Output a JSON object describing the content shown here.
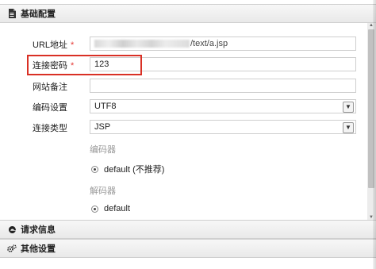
{
  "sections": {
    "basic": {
      "title": "基础配置",
      "icon": "document-icon"
    },
    "request": {
      "title": "请求信息",
      "icon": "edge-icon"
    },
    "other": {
      "title": "其他设置",
      "icon": "gears-icon"
    }
  },
  "form": {
    "url": {
      "label": "URL地址",
      "required": "*",
      "value_suffix": "/text/a.jsp"
    },
    "password": {
      "label": "连接密码",
      "required": "*",
      "value": "123"
    },
    "note": {
      "label": "网站备注",
      "value": ""
    },
    "encoding": {
      "label": "编码设置",
      "value": "UTF8"
    },
    "conn_type": {
      "label": "连接类型",
      "value": "JSP"
    },
    "encoder": {
      "label": "编码器",
      "option": "default (不推荐)"
    },
    "decoder": {
      "label": "解码器",
      "option": "default"
    }
  },
  "colors": {
    "highlight_border": "#d93025",
    "required_star": "#e53935"
  }
}
